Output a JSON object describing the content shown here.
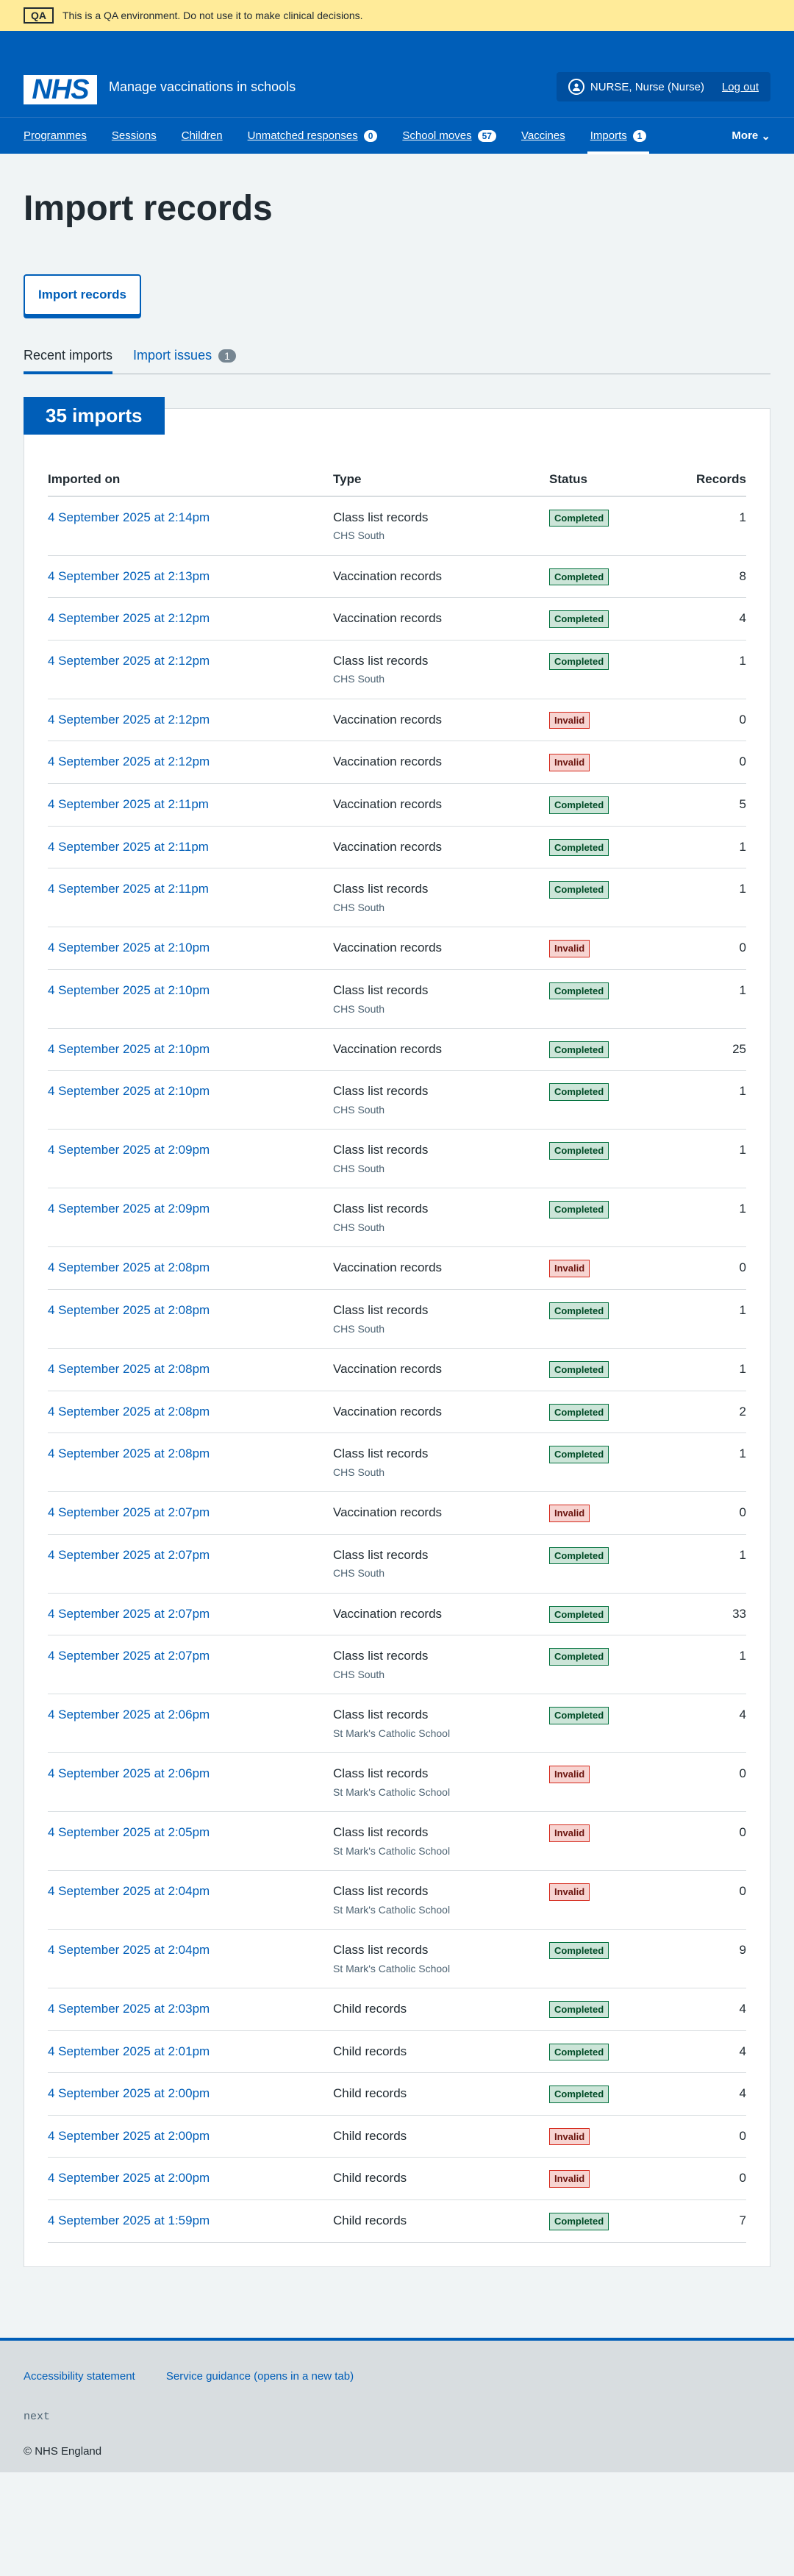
{
  "qa": {
    "tag": "QA",
    "message": "This is a QA environment. Do not use it to make clinical decisions."
  },
  "header": {
    "logo": "NHS",
    "service_name": "Manage vaccinations in schools",
    "user": "NURSE, Nurse (Nurse)",
    "logout": "Log out"
  },
  "nav": {
    "items": [
      {
        "label": "Programmes"
      },
      {
        "label": "Sessions"
      },
      {
        "label": "Children"
      },
      {
        "label": "Unmatched responses",
        "count": "0"
      },
      {
        "label": "School moves",
        "count": "57"
      },
      {
        "label": "Vaccines"
      },
      {
        "label": "Imports",
        "count": "1"
      }
    ],
    "more": "More"
  },
  "page": {
    "title": "Import records",
    "import_button": "Import records",
    "tabs": [
      {
        "label": "Recent imports"
      },
      {
        "label": "Import issues",
        "count": "1"
      }
    ],
    "card_heading": "35 imports"
  },
  "table": {
    "headers": [
      "Imported on",
      "Type",
      "Status",
      "Records"
    ],
    "rows": [
      {
        "date": "4 September 2025 at 2:14pm",
        "type": "Class list records",
        "sub": "CHS South",
        "status": "Completed",
        "records": "1"
      },
      {
        "date": "4 September 2025 at 2:13pm",
        "type": "Vaccination records",
        "sub": "",
        "status": "Completed",
        "records": "8"
      },
      {
        "date": "4 September 2025 at 2:12pm",
        "type": "Vaccination records",
        "sub": "",
        "status": "Completed",
        "records": "4"
      },
      {
        "date": "4 September 2025 at 2:12pm",
        "type": "Class list records",
        "sub": "CHS South",
        "status": "Completed",
        "records": "1"
      },
      {
        "date": "4 September 2025 at 2:12pm",
        "type": "Vaccination records",
        "sub": "",
        "status": "Invalid",
        "records": "0"
      },
      {
        "date": "4 September 2025 at 2:12pm",
        "type": "Vaccination records",
        "sub": "",
        "status": "Invalid",
        "records": "0"
      },
      {
        "date": "4 September 2025 at 2:11pm",
        "type": "Vaccination records",
        "sub": "",
        "status": "Completed",
        "records": "5"
      },
      {
        "date": "4 September 2025 at 2:11pm",
        "type": "Vaccination records",
        "sub": "",
        "status": "Completed",
        "records": "1"
      },
      {
        "date": "4 September 2025 at 2:11pm",
        "type": "Class list records",
        "sub": "CHS South",
        "status": "Completed",
        "records": "1"
      },
      {
        "date": "4 September 2025 at 2:10pm",
        "type": "Vaccination records",
        "sub": "",
        "status": "Invalid",
        "records": "0"
      },
      {
        "date": "4 September 2025 at 2:10pm",
        "type": "Class list records",
        "sub": "CHS South",
        "status": "Completed",
        "records": "1"
      },
      {
        "date": "4 September 2025 at 2:10pm",
        "type": "Vaccination records",
        "sub": "",
        "status": "Completed",
        "records": "25"
      },
      {
        "date": "4 September 2025 at 2:10pm",
        "type": "Class list records",
        "sub": "CHS South",
        "status": "Completed",
        "records": "1"
      },
      {
        "date": "4 September 2025 at 2:09pm",
        "type": "Class list records",
        "sub": "CHS South",
        "status": "Completed",
        "records": "1"
      },
      {
        "date": "4 September 2025 at 2:09pm",
        "type": "Class list records",
        "sub": "CHS South",
        "status": "Completed",
        "records": "1"
      },
      {
        "date": "4 September 2025 at 2:08pm",
        "type": "Vaccination records",
        "sub": "",
        "status": "Invalid",
        "records": "0"
      },
      {
        "date": "4 September 2025 at 2:08pm",
        "type": "Class list records",
        "sub": "CHS South",
        "status": "Completed",
        "records": "1"
      },
      {
        "date": "4 September 2025 at 2:08pm",
        "type": "Vaccination records",
        "sub": "",
        "status": "Completed",
        "records": "1"
      },
      {
        "date": "4 September 2025 at 2:08pm",
        "type": "Vaccination records",
        "sub": "",
        "status": "Completed",
        "records": "2"
      },
      {
        "date": "4 September 2025 at 2:08pm",
        "type": "Class list records",
        "sub": "CHS South",
        "status": "Completed",
        "records": "1"
      },
      {
        "date": "4 September 2025 at 2:07pm",
        "type": "Vaccination records",
        "sub": "",
        "status": "Invalid",
        "records": "0"
      },
      {
        "date": "4 September 2025 at 2:07pm",
        "type": "Class list records",
        "sub": "CHS South",
        "status": "Completed",
        "records": "1"
      },
      {
        "date": "4 September 2025 at 2:07pm",
        "type": "Vaccination records",
        "sub": "",
        "status": "Completed",
        "records": "33"
      },
      {
        "date": "4 September 2025 at 2:07pm",
        "type": "Class list records",
        "sub": "CHS South",
        "status": "Completed",
        "records": "1"
      },
      {
        "date": "4 September 2025 at 2:06pm",
        "type": "Class list records",
        "sub": "St Mark's Catholic School",
        "status": "Completed",
        "records": "4"
      },
      {
        "date": "4 September 2025 at 2:06pm",
        "type": "Class list records",
        "sub": "St Mark's Catholic School",
        "status": "Invalid",
        "records": "0"
      },
      {
        "date": "4 September 2025 at 2:05pm",
        "type": "Class list records",
        "sub": "St Mark's Catholic School",
        "status": "Invalid",
        "records": "0"
      },
      {
        "date": "4 September 2025 at 2:04pm",
        "type": "Class list records",
        "sub": "St Mark's Catholic School",
        "status": "Invalid",
        "records": "0"
      },
      {
        "date": "4 September 2025 at 2:04pm",
        "type": "Class list records",
        "sub": "St Mark's Catholic School",
        "status": "Completed",
        "records": "9"
      },
      {
        "date": "4 September 2025 at 2:03pm",
        "type": "Child records",
        "sub": "",
        "status": "Completed",
        "records": "4"
      },
      {
        "date": "4 September 2025 at 2:01pm",
        "type": "Child records",
        "sub": "",
        "status": "Completed",
        "records": "4"
      },
      {
        "date": "4 September 2025 at 2:00pm",
        "type": "Child records",
        "sub": "",
        "status": "Completed",
        "records": "4"
      },
      {
        "date": "4 September 2025 at 2:00pm",
        "type": "Child records",
        "sub": "",
        "status": "Invalid",
        "records": "0"
      },
      {
        "date": "4 September 2025 at 2:00pm",
        "type": "Child records",
        "sub": "",
        "status": "Invalid",
        "records": "0"
      },
      {
        "date": "4 September 2025 at 1:59pm",
        "type": "Child records",
        "sub": "",
        "status": "Completed",
        "records": "7"
      }
    ]
  },
  "footer": {
    "links": [
      "Accessibility statement",
      "Service guidance (opens in a new tab)"
    ],
    "env": "next",
    "copyright": "© NHS England"
  },
  "colors": {
    "brand": "#005eb8",
    "completed": "#00703c",
    "invalid": "#d5281b",
    "qa_banner": "#ffeb99"
  }
}
